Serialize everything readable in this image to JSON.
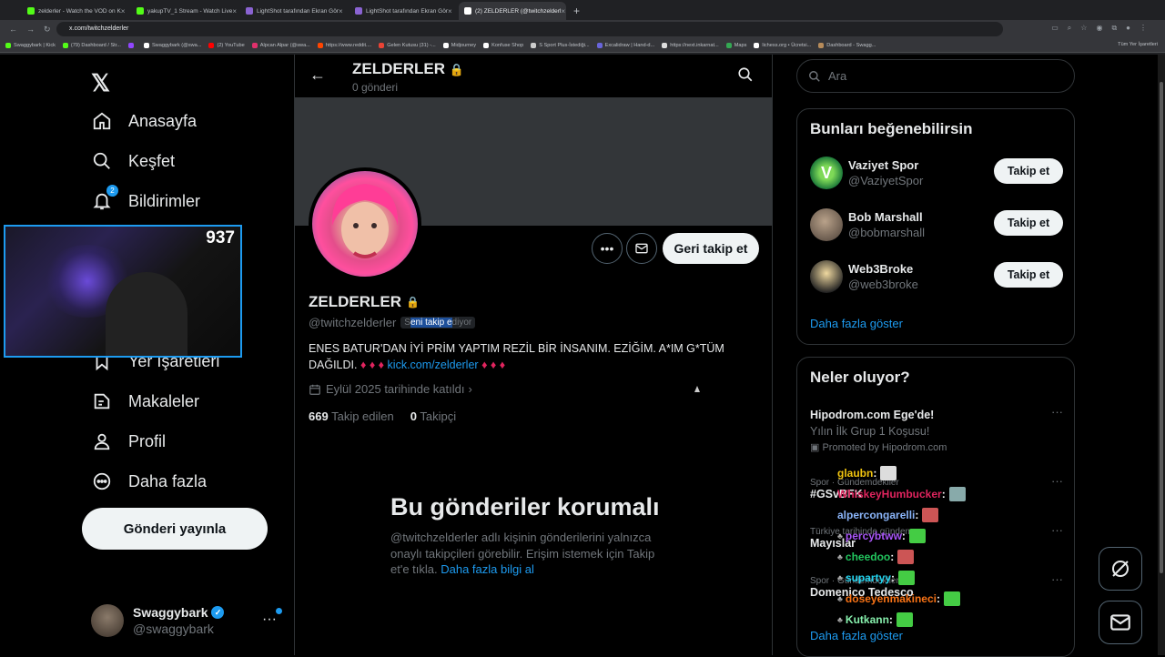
{
  "browser": {
    "tabs": [
      {
        "title": "zelderler - Watch the VOD on K",
        "color": "#53fc18",
        "active": false
      },
      {
        "title": "yakupTV_1 Stream - Watch Live",
        "color": "#53fc18",
        "active": false
      },
      {
        "title": "LightShot tarafından Ekran Gör",
        "color": "#8a63d2",
        "active": false
      },
      {
        "title": "LightShot tarafından Ekran Gör",
        "color": "#8a63d2",
        "active": false
      },
      {
        "title": "(2) ZELDERLER (@twitchzelderl",
        "color": "#ffffff",
        "active": true
      }
    ],
    "url": "x.com/twitchzelderler",
    "bookmarks": [
      {
        "label": "Swaggybark | Kick",
        "color": "#53fc18"
      },
      {
        "label": "(79) Dashboard / Str...",
        "color": "#53fc18"
      },
      {
        "label": "",
        "color": "#9146ff"
      },
      {
        "label": "Swaggybark (@swa...",
        "color": "#ffffff"
      },
      {
        "label": "(2) YouTube",
        "color": "#ff0000"
      },
      {
        "label": "Alpcan Alpar (@swa...",
        "color": "#e1306c"
      },
      {
        "label": "https://www.reddit....",
        "color": "#ff4500"
      },
      {
        "label": "Gelen Kutusu (31) -...",
        "color": "#ea4335"
      },
      {
        "label": "Midjourney",
        "color": "#ffffff"
      },
      {
        "label": "Konfuse Shop",
        "color": "#ffffff"
      },
      {
        "label": "S Sport Plus-İstediği...",
        "color": "#cccccc"
      },
      {
        "label": "Excalidraw | Hand-d...",
        "color": "#6965db"
      },
      {
        "label": "https://next.inkarnat...",
        "color": "#dddddd"
      },
      {
        "label": "Maps",
        "color": "#34a853"
      },
      {
        "label": "lichess.org • Ücretsi...",
        "color": "#ffffff"
      },
      {
        "label": "Dashboard - Swagg...",
        "color": "#b68b5a"
      }
    ],
    "bookmarks_right": "Tüm Yer İşaretleri"
  },
  "nav": {
    "home": "Anasayfa",
    "explore": "Keşfet",
    "notifications": "Bildirimler",
    "notifications_badge": "2",
    "bookmarks": "Yer İşaretleri",
    "articles": "Makaleler",
    "profile": "Profil",
    "more": "Daha fazla",
    "post_button": "Gönderi yayınla"
  },
  "me": {
    "name": "Swaggybark",
    "handle": "@swaggybark"
  },
  "webcam": {
    "viewer_count": "937"
  },
  "profile": {
    "header_title": "ZELDERLER",
    "header_posts": "0 gönderi",
    "name": "ZELDERLER",
    "handle": "@twitchzelderler",
    "follows_you_part1": "S",
    "follows_you_part2": "eni takip e",
    "follows_you_part3": "diyor",
    "bio_text": "ENES BATUR'DAN İYİ PRİM YAPTIM REZİL BİR İNSANIM.  EZİĞİM.  A*IM G*TÜM DAĞILDI. ",
    "bio_diamonds1": "♦ ♦ ♦",
    "bio_link": "kick.com/zelderler",
    "bio_diamonds2": "♦ ♦ ♦",
    "joined": "Eylül 2025 tarihinde katıldı",
    "following_count": "669",
    "following_label": "Takip edilen",
    "followers_count": "0",
    "followers_label": "Takipçi",
    "follow_back": "Geri takip et",
    "protected_title": "Bu gönderiler korumalı",
    "protected_text": "@twitchzelderler adlı kişinin gönderilerini yalnızca onaylı takipçileri görebilir. Erişim istemek için Takip et'e tıkla. ",
    "protected_link": "Daha fazla bilgi al"
  },
  "right": {
    "search_placeholder": "Ara",
    "who_to_follow_title": "Bunları beğenebilirsin",
    "suggestions": [
      {
        "name": "Vaziyet Spor",
        "handle": "@VaziyetSpor",
        "button": "Takip et"
      },
      {
        "name": "Bob Marshall",
        "handle": "@bobmarshall",
        "button": "Takip et"
      },
      {
        "name": "Web3Broke",
        "handle": "@web3broke",
        "button": "Takip et"
      }
    ],
    "show_more": "Daha fazla göster",
    "trends_title": "Neler oluyor?",
    "trends": [
      {
        "title": "Hipodrom.com Ege'de!",
        "subtitle": "Yılın İlk Grup 1 Koşusu!",
        "promo": "Promoted by Hipodrom.com"
      },
      {
        "context": "Spor · Gündemdekiler",
        "title": "#GSvBFK"
      },
      {
        "context": "Türkiye tarihinde gündem",
        "title": "Mayıslar"
      },
      {
        "context": "Spor · Gündemdekiler",
        "title": "Domenico Tedesco"
      }
    ],
    "trends_show_more": "Daha fazla göster"
  },
  "chat": [
    {
      "user": "glaubn",
      "sep": " :",
      "color": "#f1c40f"
    },
    {
      "user": "WhiskeyHumbucker",
      "sep": " :",
      "color": "#e0245e"
    },
    {
      "user": "alpercongarelli",
      "sep": " :",
      "color": "#8ab4f8"
    },
    {
      "user": "percybtww",
      "sep": " :",
      "color": "#a855f7"
    },
    {
      "user": "cheedoo",
      "sep": " :",
      "color": "#22c55e"
    },
    {
      "user": "supartyy",
      "sep": " :",
      "color": "#22d3ee"
    },
    {
      "user": "doseyenmakineci",
      "sep": " :",
      "color": "#f97316"
    },
    {
      "user": "Kutkann",
      "sep": " :",
      "color": "#86efac"
    }
  ]
}
